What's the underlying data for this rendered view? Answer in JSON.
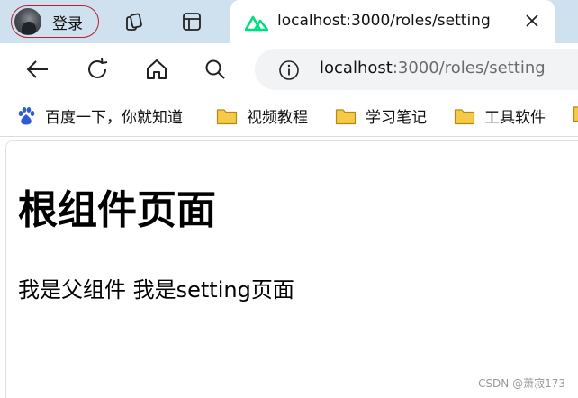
{
  "browser": {
    "profile": {
      "label": "登录"
    },
    "tabs": [
      {
        "title": "localhost:3000/roles/setting",
        "active": true
      }
    ],
    "address_bar": {
      "host": "localhost",
      "rest": ":3000/roles/setting"
    },
    "bookmarks": [
      {
        "label": "百度一下，你就知道",
        "icon": "paw-icon"
      },
      {
        "label": "视频教程",
        "icon": "folder-icon"
      },
      {
        "label": "学习笔记",
        "icon": "folder-icon"
      },
      {
        "label": "工具软件",
        "icon": "folder-icon"
      }
    ]
  },
  "page": {
    "heading": "根组件页面",
    "paragraph": "我是父组件 我是setting页面"
  },
  "watermark": "CSDN @萧寂173",
  "colors": {
    "tabbar": "#cfe0ee",
    "profile_ring": "#b4232b",
    "nuxt_green": "#00dc82",
    "folder": "#f7c948"
  }
}
